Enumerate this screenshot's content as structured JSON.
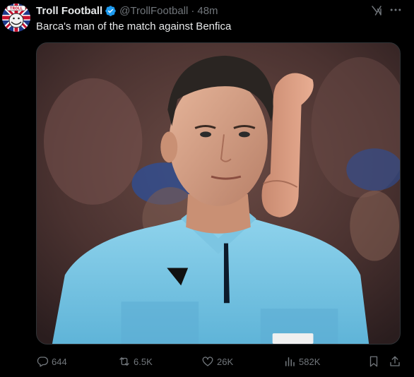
{
  "tweet": {
    "display_name": "Troll Football",
    "handle": "@TrollFootball",
    "separator": "·",
    "time": "48m",
    "text": "Barca's man of the match against Benfica"
  },
  "avatar": {
    "badge_text": "TROLL",
    "icon": "union-jack-troll-face-avatar"
  },
  "media": {
    "icon": "referee-photo",
    "colors": {
      "shirt": "#7ec8e3",
      "background": "#5a3a3a"
    }
  },
  "actions": {
    "reply_count": "644",
    "retweet_count": "6.5K",
    "like_count": "26K",
    "views_count": "582K"
  },
  "icons": {
    "verified": "verified-badge-icon",
    "grok": "grok-icon",
    "more": "more-icon",
    "reply": "reply-icon",
    "retweet": "retweet-icon",
    "like": "heart-icon",
    "views": "views-chart-icon",
    "bookmark": "bookmark-icon",
    "share": "share-icon"
  },
  "colors": {
    "background": "#000000",
    "text_primary": "#e7e9ea",
    "text_secondary": "#71767b",
    "verified_blue": "#1d9bf0",
    "border": "#2f3336"
  }
}
